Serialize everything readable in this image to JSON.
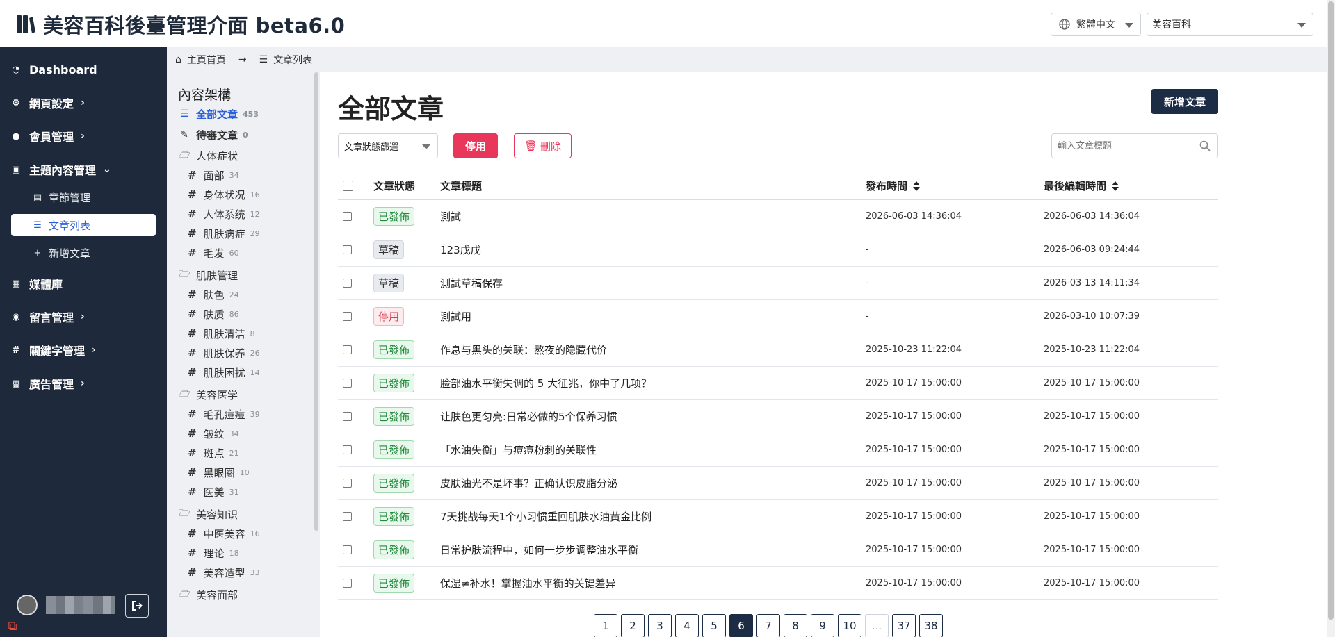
{
  "header": {
    "title": "美容百科後臺管理介面 beta6.0",
    "language": "繁體中文",
    "site": "美容百科"
  },
  "sidebar": {
    "items": [
      {
        "label": "Dashboard",
        "icon": "dashboard-icon"
      },
      {
        "label": "網頁設定",
        "icon": "gear-icon"
      },
      {
        "label": "會員管理",
        "icon": "users-icon"
      },
      {
        "label": "主題內容管理",
        "icon": "folder-icon"
      },
      {
        "label": "媒體庫",
        "icon": "images-icon"
      },
      {
        "label": "留言管理",
        "icon": "comment-icon"
      },
      {
        "label": "關鍵字管理",
        "icon": "hashtag-icon"
      },
      {
        "label": "廣告管理",
        "icon": "ad-icon"
      }
    ],
    "sub_items": [
      {
        "label": "章節管理",
        "icon": "sections-icon"
      },
      {
        "label": "文章列表",
        "icon": "list-icon"
      },
      {
        "label": "新增文章",
        "icon": "plus-icon"
      }
    ]
  },
  "breadcrumb": {
    "home": "主頁首頁",
    "current": "文章列表"
  },
  "tree": {
    "title": "內容架構",
    "all": {
      "label": "全部文章",
      "count": "453"
    },
    "pending": {
      "label": "待審文章",
      "count": "0"
    },
    "groups": [
      {
        "label": "人体症状",
        "children": [
          {
            "label": "面部",
            "count": "34"
          },
          {
            "label": "身体状况",
            "count": "16"
          },
          {
            "label": "人体系统",
            "count": "12"
          },
          {
            "label": "肌肤病症",
            "count": "29"
          },
          {
            "label": "毛发",
            "count": "60"
          }
        ]
      },
      {
        "label": "肌肤管理",
        "children": [
          {
            "label": "肤色",
            "count": "24"
          },
          {
            "label": "肤质",
            "count": "86"
          },
          {
            "label": "肌肤清洁",
            "count": "8"
          },
          {
            "label": "肌肤保养",
            "count": "26"
          },
          {
            "label": "肌肤困扰",
            "count": "14"
          }
        ]
      },
      {
        "label": "美容医学",
        "children": [
          {
            "label": "毛孔痘痘",
            "count": "39"
          },
          {
            "label": "皱纹",
            "count": "34"
          },
          {
            "label": "斑点",
            "count": "21"
          },
          {
            "label": "黑眼圈",
            "count": "10"
          },
          {
            "label": "医美",
            "count": "31"
          }
        ]
      },
      {
        "label": "美容知识",
        "children": [
          {
            "label": "中医美容",
            "count": "16"
          },
          {
            "label": "理论",
            "count": "18"
          },
          {
            "label": "美容造型",
            "count": "33"
          }
        ]
      },
      {
        "label": "美容面部",
        "children": []
      }
    ]
  },
  "main": {
    "title": "全部文章",
    "new_button": "新增文章",
    "filter_placeholder": "文章狀態篩選",
    "disable_button": "停用",
    "delete_button": "刪除",
    "search_placeholder": "輸入文章標題",
    "columns": {
      "status": "文章狀態",
      "title": "文章標題",
      "published": "發布時間",
      "edited": "最後編輯時間"
    },
    "rows": [
      {
        "status": "已發佈",
        "type": "published",
        "title": "測試",
        "published": "2026-06-03 14:36:04",
        "edited": "2026-06-03 14:36:04"
      },
      {
        "status": "草稿",
        "type": "draft",
        "title": "123戊戊",
        "published": "-",
        "edited": "2026-06-03 09:24:44"
      },
      {
        "status": "草稿",
        "type": "draft",
        "title": "測試草稿保存",
        "published": "-",
        "edited": "2026-03-13 14:11:34"
      },
      {
        "status": "停用",
        "type": "disabled",
        "title": "測試用",
        "published": "-",
        "edited": "2026-03-10 10:07:39"
      },
      {
        "status": "已發佈",
        "type": "published",
        "title": "作息与黑头的关联：熬夜的隐藏代价",
        "published": "2025-10-23 11:22:04",
        "edited": "2025-10-23 11:22:04"
      },
      {
        "status": "已發佈",
        "type": "published",
        "title": "脸部油水平衡失调的 5 大征兆，你中了几项？",
        "published": "2025-10-17 15:00:00",
        "edited": "2025-10-17 15:00:00"
      },
      {
        "status": "已發佈",
        "type": "published",
        "title": "让肤色更匀亮:日常必做的5个保养习惯",
        "published": "2025-10-17 15:00:00",
        "edited": "2025-10-17 15:00:00"
      },
      {
        "status": "已發佈",
        "type": "published",
        "title": "「水油失衡」与痘痘粉刺的关联性",
        "published": "2025-10-17 15:00:00",
        "edited": "2025-10-17 15:00:00"
      },
      {
        "status": "已發佈",
        "type": "published",
        "title": "皮肤油光不是坏事？正确认识皮脂分泌",
        "published": "2025-10-17 15:00:00",
        "edited": "2025-10-17 15:00:00"
      },
      {
        "status": "已發佈",
        "type": "published",
        "title": "7天挑战每天1个小习惯重回肌肤水油黄金比例",
        "published": "2025-10-17 15:00:00",
        "edited": "2025-10-17 15:00:00"
      },
      {
        "status": "已發佈",
        "type": "published",
        "title": "日常护肤流程中，如何一步步调整油水平衡",
        "published": "2025-10-17 15:00:00",
        "edited": "2025-10-17 15:00:00"
      },
      {
        "status": "已發佈",
        "type": "published",
        "title": "保湿≠补水！掌握油水平衡的关键差异",
        "published": "2025-10-17 15:00:00",
        "edited": "2025-10-17 15:00:00"
      }
    ],
    "pagination": [
      "1",
      "2",
      "3",
      "4",
      "5",
      "6",
      "7",
      "8",
      "9",
      "10",
      "...",
      "37",
      "38"
    ],
    "active_page": "6"
  },
  "colors": {
    "sidebar_bg": "#1e2a3b",
    "primary_dark": "#1c2c45",
    "danger": "#e8375a",
    "published_green": "#1f8a3b",
    "active_blue": "#2b5fd9"
  }
}
